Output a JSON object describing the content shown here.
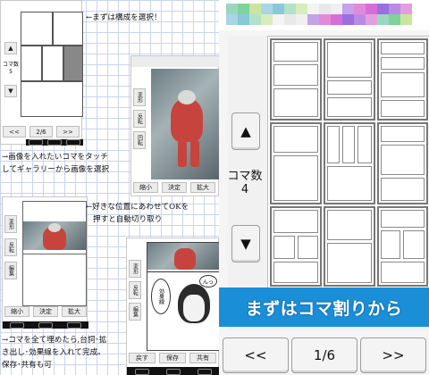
{
  "left": {
    "captions": {
      "step1": "←まずは構成を選択！",
      "step2_line1": "→画像を入れたいコマをタッチ",
      "step2_line2": "してギャラリーから画像を選択",
      "step3_line1": "←好きな位置にあわせてOKを",
      "step3_line2": "押すと自動切り取り",
      "step4_line1": "→コマを全て埋めたら,台詞･拡",
      "step4_line2": "き出し･効果線を入れて完成。",
      "step4_line3": "保存･共有も可"
    },
    "mini_layout": {
      "koma_label": "コマ数\n5",
      "up": "▲",
      "down": "▼",
      "prev": "<<",
      "page": "2/6",
      "next": ">>"
    },
    "mini_photo_screen": {
      "side_buttons": [
        "変形",
        "反転",
        "回転"
      ],
      "shrink": "縮小",
      "ok": "決定",
      "expand": "拡大"
    },
    "mini_crop_screen": {
      "side_buttons": [
        "変形",
        "反転",
        "編集"
      ],
      "shrink": "縮小",
      "ok": "決定",
      "expand": "拡大"
    },
    "mini_manga_screen": {
      "side_buttons": [
        "変形",
        "反転",
        "編集"
      ],
      "bubble": "効果線",
      "bubble2": "んっ",
      "bottom_buttons": [
        "戻す",
        "保存",
        "共有"
      ]
    }
  },
  "app": {
    "koma_label": "コマ数",
    "koma_count": "4",
    "up_label": "▲",
    "down_label": "▼",
    "banner": "まずはコマ割りから",
    "prev_label": "<<",
    "page_indicator": "1/6",
    "next_label": ">>",
    "swatch_colors": [
      "#9ad7c0",
      "#7fd39a",
      "#c9e59f",
      "#a8d6e6",
      "#88c9d8",
      "#b3e2c9",
      "#d6eebb",
      "#f4f4f4",
      "#e9e9e9",
      "#f0f0f0",
      "#c6a2e8",
      "#e28ad8",
      "#d56fd6",
      "#9a6fe0",
      "#b98be6",
      "#e39ee0"
    ]
  }
}
